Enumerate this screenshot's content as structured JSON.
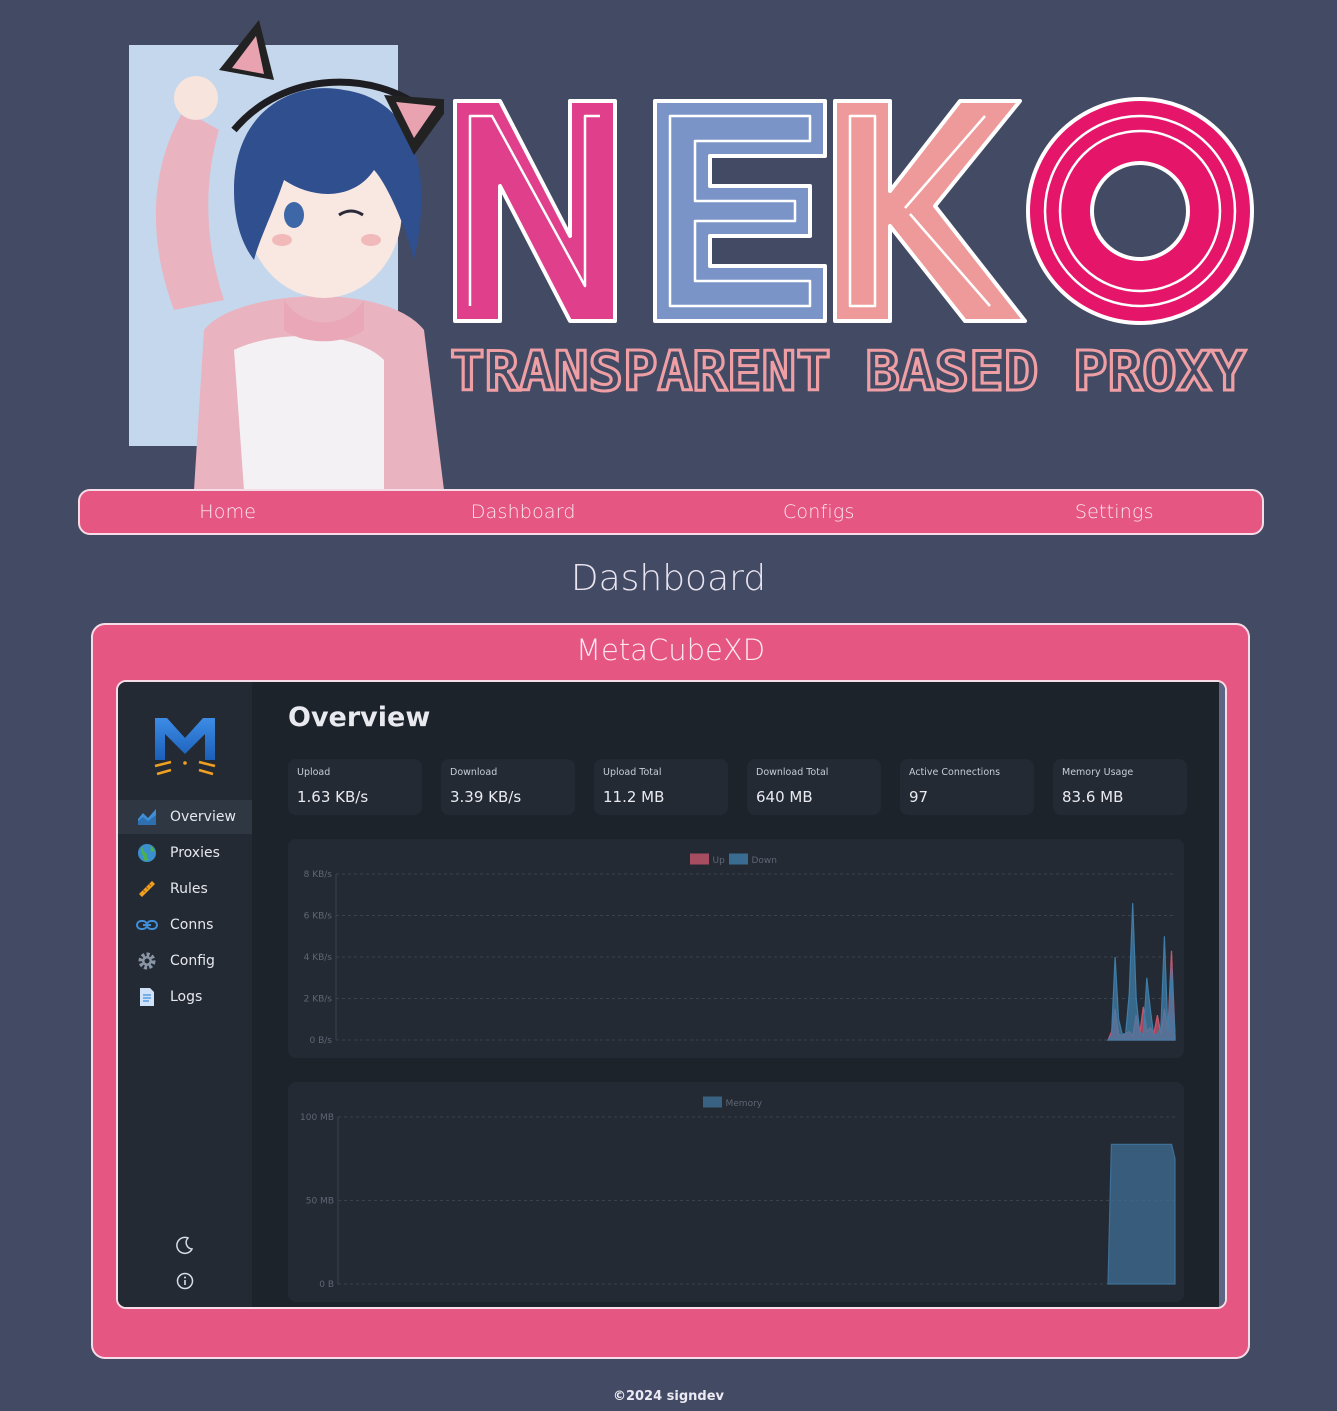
{
  "banner": {
    "logo_letters": [
      "N",
      "E",
      "K",
      "O"
    ],
    "logo_colors": [
      "#e03f8c",
      "#7b94c8",
      "#ef9a9a",
      "#e5166a"
    ],
    "subtitle": "TRANSPARENT BASED PROXY"
  },
  "nav": {
    "items": [
      {
        "label": "Home"
      },
      {
        "label": "Dashboard"
      },
      {
        "label": "Configs"
      },
      {
        "label": "Settings"
      }
    ]
  },
  "page": {
    "title": "Dashboard",
    "card_title": "MetaCubeXD"
  },
  "dashboard": {
    "sidebar": {
      "items": [
        {
          "label": "Overview",
          "icon": "chart-area-icon",
          "active": true
        },
        {
          "label": "Proxies",
          "icon": "globe-icon"
        },
        {
          "label": "Rules",
          "icon": "ruler-icon"
        },
        {
          "label": "Conns",
          "icon": "link-icon"
        },
        {
          "label": "Config",
          "icon": "gear-icon"
        },
        {
          "label": "Logs",
          "icon": "document-icon"
        }
      ],
      "bottom_icons": [
        "moon-icon",
        "info-icon"
      ]
    },
    "overview_title": "Overview",
    "stats": [
      {
        "label": "Upload",
        "value": "1.63 KB/s"
      },
      {
        "label": "Download",
        "value": "3.39 KB/s"
      },
      {
        "label": "Upload Total",
        "value": "11.2 MB"
      },
      {
        "label": "Download Total",
        "value": "640 MB"
      },
      {
        "label": "Active Connections",
        "value": "97"
      },
      {
        "label": "Memory Usage",
        "value": "83.6 MB"
      }
    ],
    "colors": {
      "up": "#c8566e",
      "down": "#3f7da8",
      "memory": "#3f6f96"
    }
  },
  "chart_data": [
    {
      "type": "area",
      "legend": [
        "Up",
        "Down"
      ],
      "legend_position": "top-center",
      "y_ticks": [
        "8 KB/s",
        "6 KB/s",
        "4 KB/s",
        "2 KB/s",
        "0 B/s"
      ],
      "ylim": [
        0,
        8
      ],
      "grid": true,
      "series": [
        {
          "name": "Up",
          "values": [
            0,
            0.4,
            1.5,
            0.3,
            0.2,
            0.3,
            0.4,
            0.2,
            1.2,
            0.3,
            1.6,
            0.4,
            0.6,
            0.3,
            1.2,
            0.3,
            1.5,
            0.4,
            4.3,
            0.2
          ]
        },
        {
          "name": "Down",
          "values": [
            0,
            0.2,
            4.0,
            1.0,
            0.3,
            0.3,
            2.2,
            6.6,
            2.0,
            0.4,
            0.2,
            3.0,
            1.5,
            0.2,
            0.3,
            0.6,
            5.0,
            0.4,
            3.6,
            0.2
          ]
        }
      ]
    },
    {
      "type": "area",
      "legend": [
        "Memory"
      ],
      "legend_position": "top-center",
      "y_ticks": [
        "100 MB",
        "50 MB",
        "0 B"
      ],
      "ylim": [
        0,
        100
      ],
      "grid": true,
      "series": [
        {
          "name": "Memory",
          "values": [
            0,
            83.6,
            83.6,
            83.6,
            83.6,
            83.6,
            83.6,
            83.6,
            83.6,
            83.6,
            83.6,
            83.6,
            83.6,
            83.6,
            83.6,
            83.6,
            83.6,
            83.6,
            83.6,
            83.6,
            75
          ]
        }
      ]
    }
  ],
  "footer": {
    "text": "©2024 signdev"
  }
}
